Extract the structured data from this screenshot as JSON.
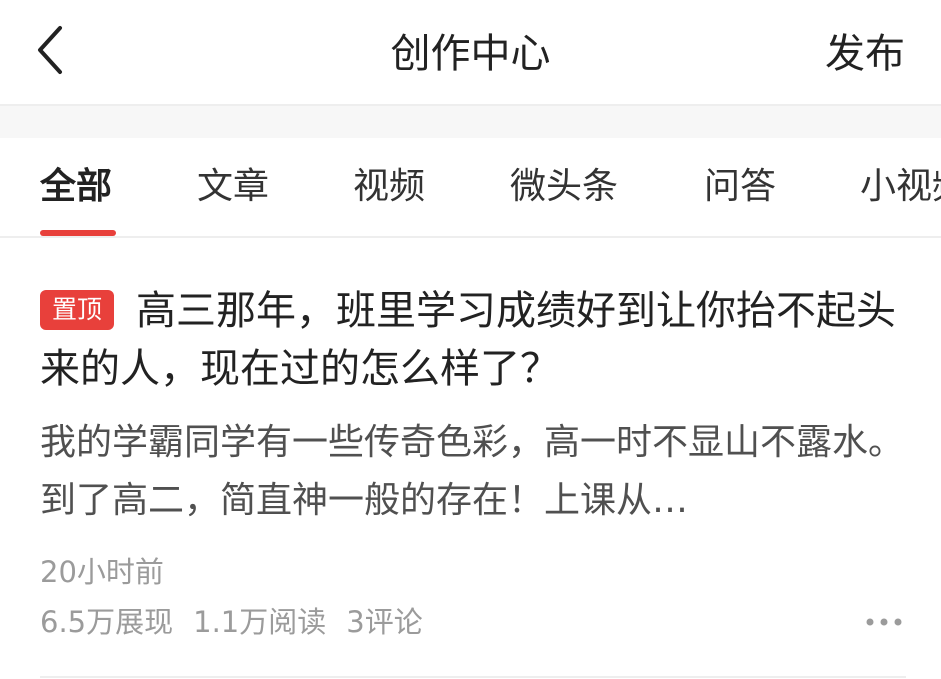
{
  "header": {
    "title": "创作中心",
    "publish_label": "发布",
    "back_icon": "chevron-left-icon"
  },
  "tabs": [
    {
      "label": "全部",
      "active": true
    },
    {
      "label": "文章",
      "active": false
    },
    {
      "label": "视频",
      "active": false
    },
    {
      "label": "微头条",
      "active": false
    },
    {
      "label": "问答",
      "active": false
    },
    {
      "label": "小视频",
      "active": false
    }
  ],
  "article": {
    "badge": "置顶",
    "title": "高三那年，班里学习成绩好到让你抬不起头来的人，现在过的怎么样了？",
    "summary": "我的学霸同学有一些传奇色彩，高一时不显山不露水。到了高二，简直神一般的存在！上课从…",
    "time": "20小时前",
    "impressions": "6.5万展现",
    "reads": "1.1万阅读",
    "comments": "3评论",
    "more_icon": "more-dots-icon"
  },
  "colors": {
    "accent": "#e8403b",
    "text_primary": "#222222",
    "text_secondary": "#505050",
    "text_muted": "#9b9b9b",
    "divider": "#eeeeee"
  }
}
